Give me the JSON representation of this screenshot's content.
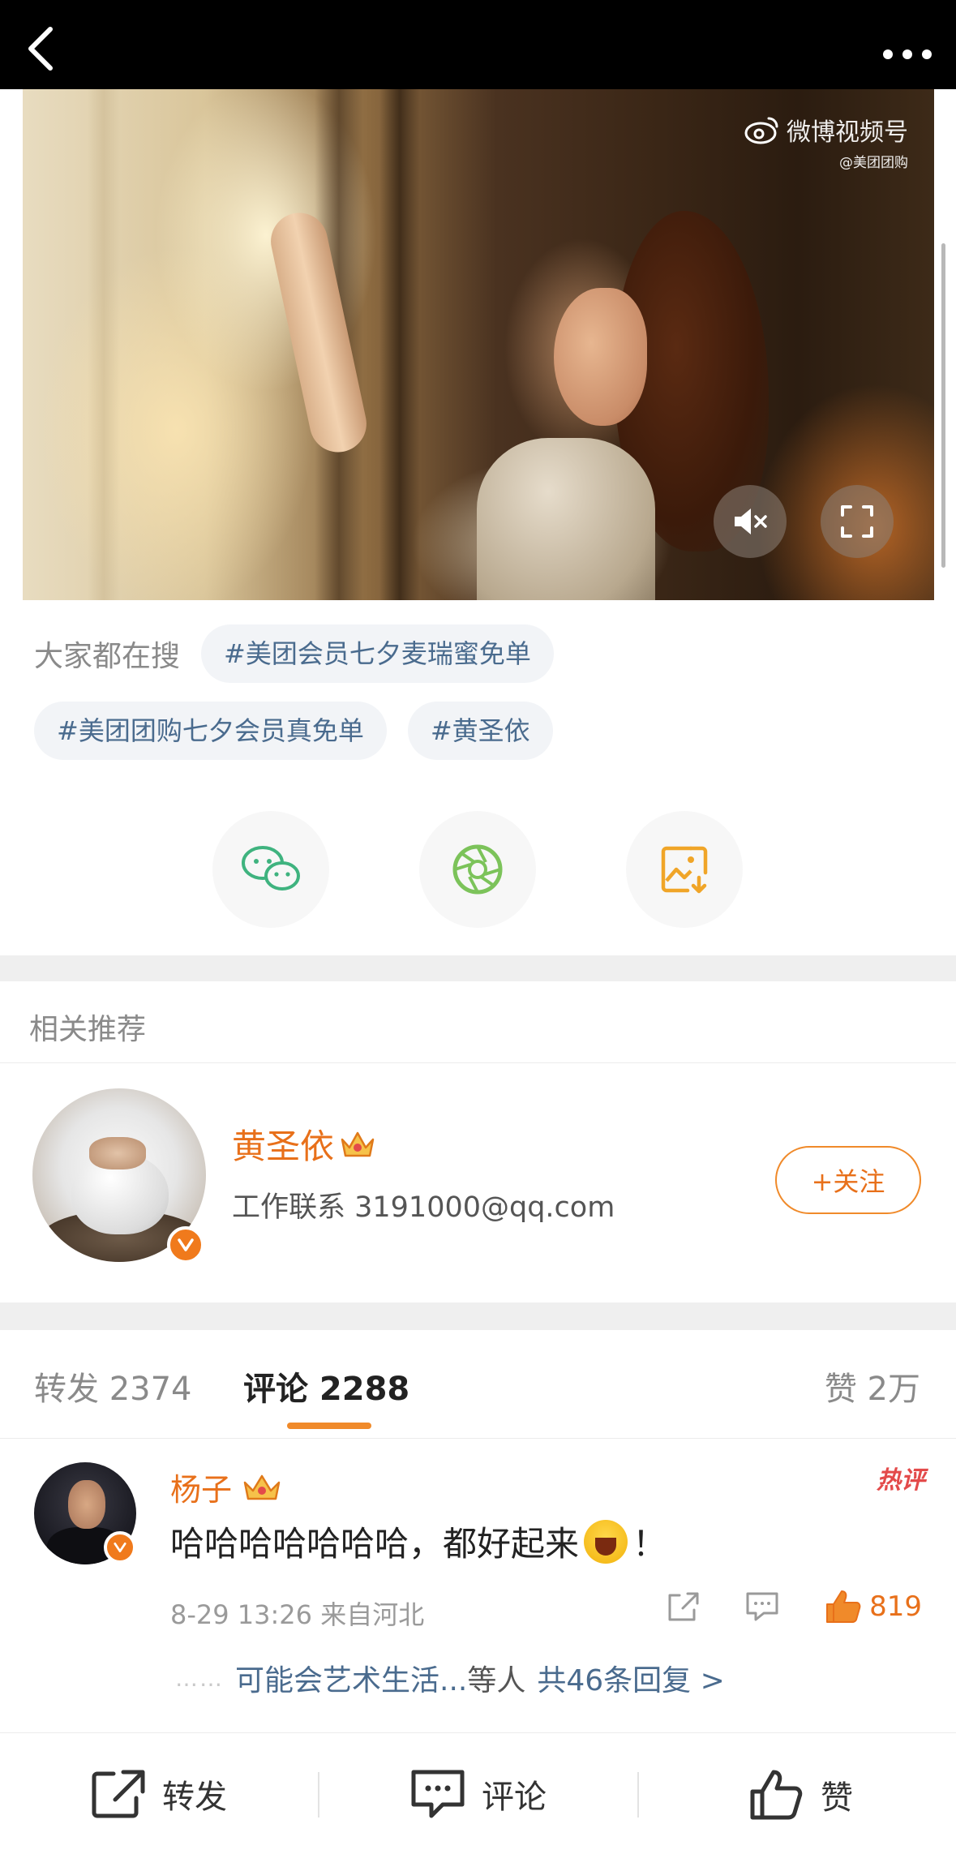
{
  "video": {
    "watermark": "微博视频号",
    "watermark_sub": "@美团团购",
    "mute_icon": "mute-icon",
    "fullscreen_icon": "fullscreen-icon"
  },
  "search": {
    "label": "大家都在搜",
    "tags": [
      "#美团会员七夕麦瑞蜜免单",
      "#美团团购七夕会员真免单",
      "#黄圣依"
    ]
  },
  "share": {
    "icons": [
      "wechat-icon",
      "moments-icon",
      "save-image-icon"
    ]
  },
  "related": {
    "title": "相关推荐",
    "name": "黄圣依",
    "description": "工作联系 3191000@qq.com",
    "follow_label": "+关注"
  },
  "tabs": {
    "forward": "转发 2374",
    "comments": "评论 2288",
    "likes": "赞 2万"
  },
  "comment": {
    "user": "杨子",
    "hot_label": "热评",
    "text": "哈哈哈哈哈哈哈，都好起来",
    "text_end": "！",
    "meta": "8-29 13:26 来自河北",
    "like_count": "819",
    "reply_dots": "……",
    "reply_user": "可能会艺术生活...",
    "reply_etc": "等人",
    "reply_more": "共46条回复 >"
  },
  "bottombar": {
    "forward": "转发",
    "comment": "评论",
    "like": "赞"
  },
  "colors": {
    "accent": "#e8701a",
    "link": "#4a6b8e",
    "hot": "#e34a4a"
  }
}
